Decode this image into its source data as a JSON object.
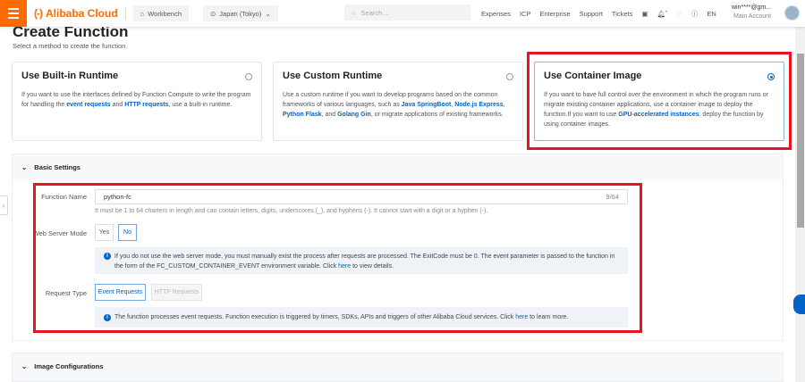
{
  "header": {
    "brand": "Alibaba Cloud",
    "workbench": "Workbench",
    "region": "Japan (Tokyo)",
    "search_placeholder": "Search...",
    "nav": [
      "Expenses",
      "ICP",
      "Enterprise",
      "Support",
      "Tickets"
    ],
    "lang": "EN",
    "account": "win****@gm...",
    "account_type": "Main Account"
  },
  "page": {
    "title": "Create Function",
    "subtitle": "Select a method to create the function."
  },
  "methods": [
    {
      "title": "Use Built-in Runtime",
      "t1": "If you want to use the interfaces defined by Function Compute to write the program for handling the ",
      "l1": "event requests",
      "t2": " and ",
      "l2": "HTTP requests",
      "t3": ", use a built-in runtime.",
      "selected": false
    },
    {
      "title": "Use Custom Runtime",
      "t1": "Use a custom runtime if you want to develop programs based on the common frameworks of various languages, such as ",
      "l1": "Java SpringBoot",
      "t2": ", ",
      "l2": "Node.js Express",
      "t3": ", ",
      "l3": "Python Flask",
      "t4": ", and ",
      "l4": "Golang Gin",
      "t5": ", or migrate applications of existing frameworks.",
      "selected": false
    },
    {
      "title": "Use Container Image",
      "t1": "If you want to have full control over the environment in which the program runs or migrate existing container applications, use a container image to deploy the function.If you want to use ",
      "l1": "GPU-accelerated instances",
      "t2": ", deploy the function by using container images.",
      "selected": true
    }
  ],
  "basic": {
    "title": "Basic Settings",
    "name_label": "Function Name",
    "name_value": "python-fc",
    "name_count": "9/64",
    "name_hint": "It must be 1 to 64 charters in length and can contain letters, digits, underscores (_), and hyphens (-). It cannot start with a digit or a hyphen (-).",
    "web_label": "Web Server Mode",
    "yes": "Yes",
    "no": "No",
    "web_info": "If you do not use the web server mode, you must manually exist the process after requests are processed. The ExitCode must be 0. The event parameter is passed to the function in the form of the FC_CUSTOM_CONTAINER_EVENT environment variable. Click ",
    "web_link": "here",
    "web_info_end": " to view details.",
    "req_label": "Request Type",
    "event": "Event Requests",
    "http": "HTTP Requests",
    "req_info": "The function processes event requests. Function execution is triggered by timers, SDKs, APIs and triggers of other Alibaba Cloud services. Click ",
    "req_link": "here",
    "req_info_end": " to learn more."
  },
  "image": {
    "title": "Image Configurations"
  }
}
